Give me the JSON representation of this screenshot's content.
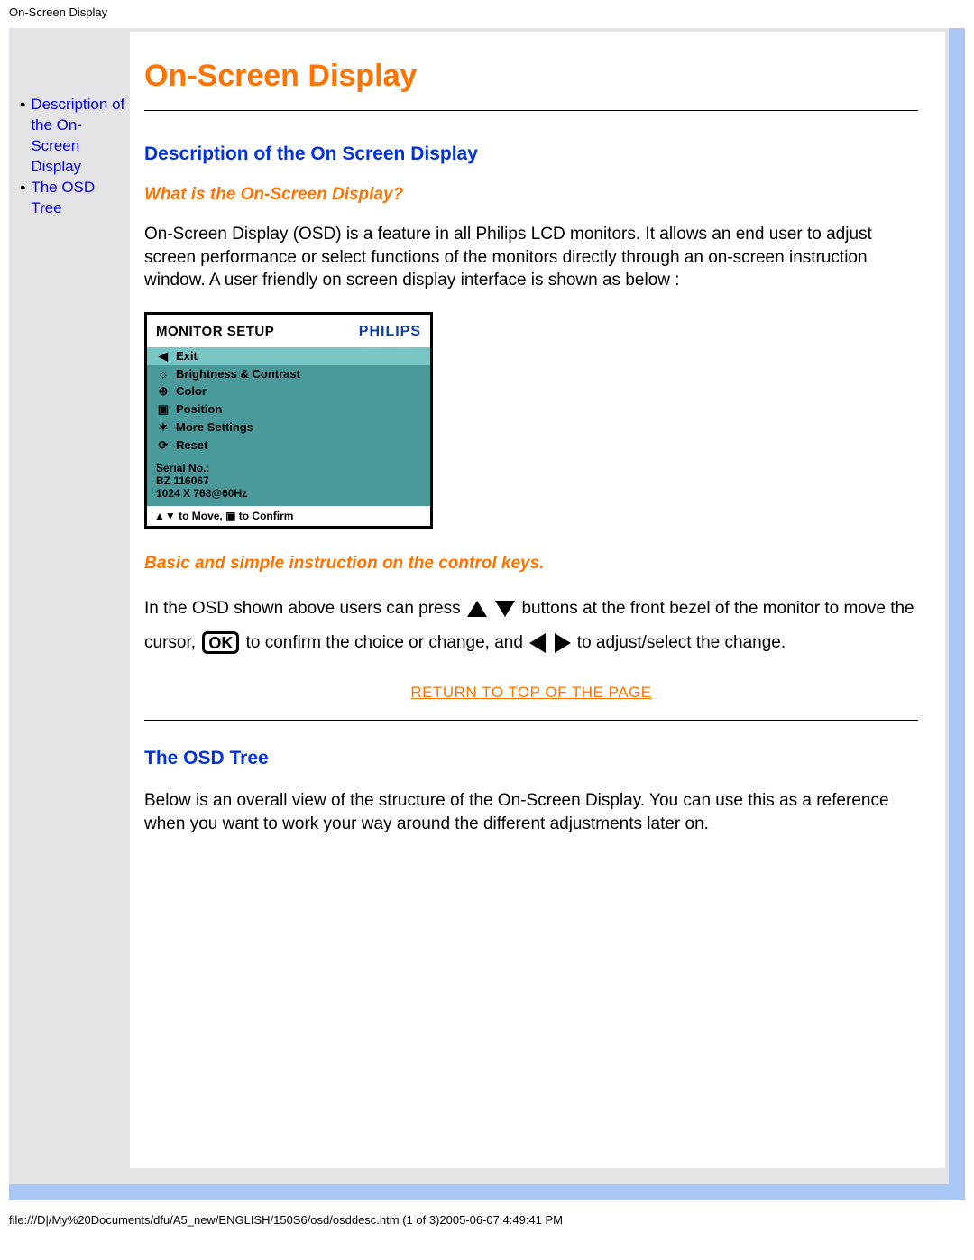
{
  "meta": {
    "header_title": "On-Screen Display"
  },
  "sidebar": {
    "items": [
      {
        "label": "Description of the On-Screen Display"
      },
      {
        "label": "The OSD Tree"
      }
    ]
  },
  "content": {
    "title": "On-Screen Display",
    "section1_heading": "Description of the On Screen Display",
    "sub1": "What is the On-Screen Display?",
    "para1": "On-Screen Display (OSD) is a feature in all Philips LCD monitors. It allows an end user to adjust screen performance or select functions of the monitors directly through an on-screen instruction window. A user friendly on screen display interface is shown as below :",
    "sub2": "Basic and simple instruction on the control keys.",
    "instr_part1": "In the OSD shown above users can press",
    "instr_part2": " buttons at the front bezel of the monitor to move the cursor,",
    "instr_part3": " to confirm the choice or change, and ",
    "instr_part4": " to adjust/select the change.",
    "return_link": "RETURN TO TOP OF THE PAGE",
    "section2_heading": "The OSD Tree",
    "para2": "Below is an overall view of the structure of the On-Screen Display. You can use this as a reference when you want to work your way around the different adjustments later on."
  },
  "osd": {
    "title": "MONITOR SETUP",
    "brand": "PHILIPS",
    "menu": [
      {
        "icon": "◀",
        "label": "Exit",
        "selected": true
      },
      {
        "icon": "☼",
        "label": "Brightness & Contrast",
        "selected": false
      },
      {
        "icon": "⊛",
        "label": "Color",
        "selected": false
      },
      {
        "icon": "▣",
        "label": "Position",
        "selected": false
      },
      {
        "icon": "✶",
        "label": "More Settings",
        "selected": false
      },
      {
        "icon": "⟳",
        "label": "Reset",
        "selected": false
      }
    ],
    "serial_label": "Serial No.:",
    "serial_value": "BZ 116067",
    "resolution": "1024 X 768@60Hz",
    "footer": "▲▼ to Move, ▣ to Confirm"
  },
  "icons": {
    "ok_label": "OK"
  },
  "footer": {
    "path": "file:///D|/My%20Documents/dfu/A5_new/ENGLISH/150S6/osd/osddesc.htm (1 of 3)2005-06-07 4:49:41 PM"
  }
}
